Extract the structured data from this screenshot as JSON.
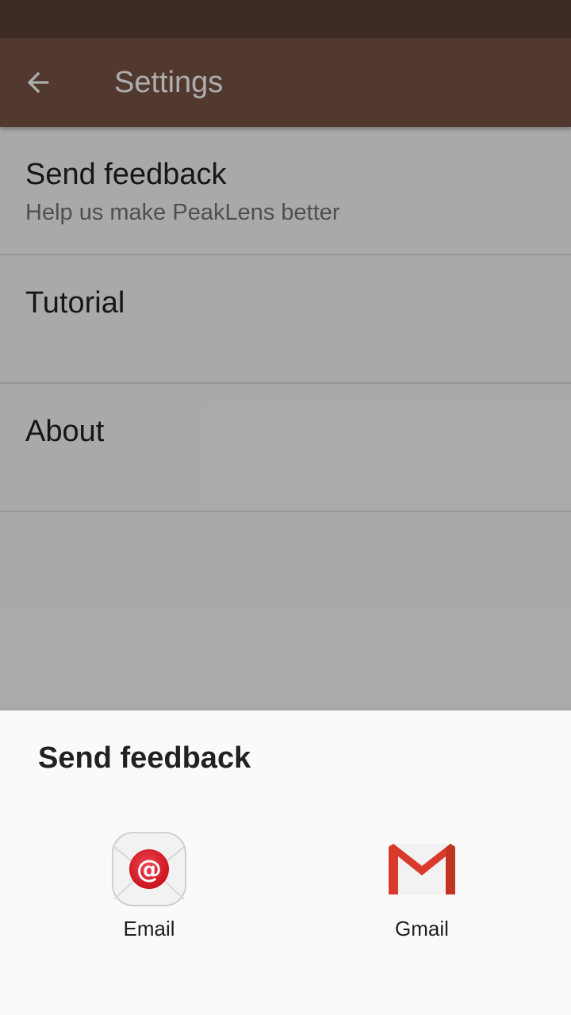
{
  "app_bar": {
    "title": "Settings",
    "back_icon": "arrow-back-icon",
    "color": "#795548"
  },
  "settings": {
    "items": [
      {
        "title": "Send feedback",
        "subtitle": "Help us make PeakLens better"
      },
      {
        "title": "Tutorial",
        "subtitle": ""
      },
      {
        "title": "About",
        "subtitle": ""
      }
    ]
  },
  "share_sheet": {
    "title": "Send feedback",
    "apps": [
      {
        "label": "Email",
        "icon": "email-app-icon"
      },
      {
        "label": "Gmail",
        "icon": "gmail-app-icon"
      }
    ]
  }
}
